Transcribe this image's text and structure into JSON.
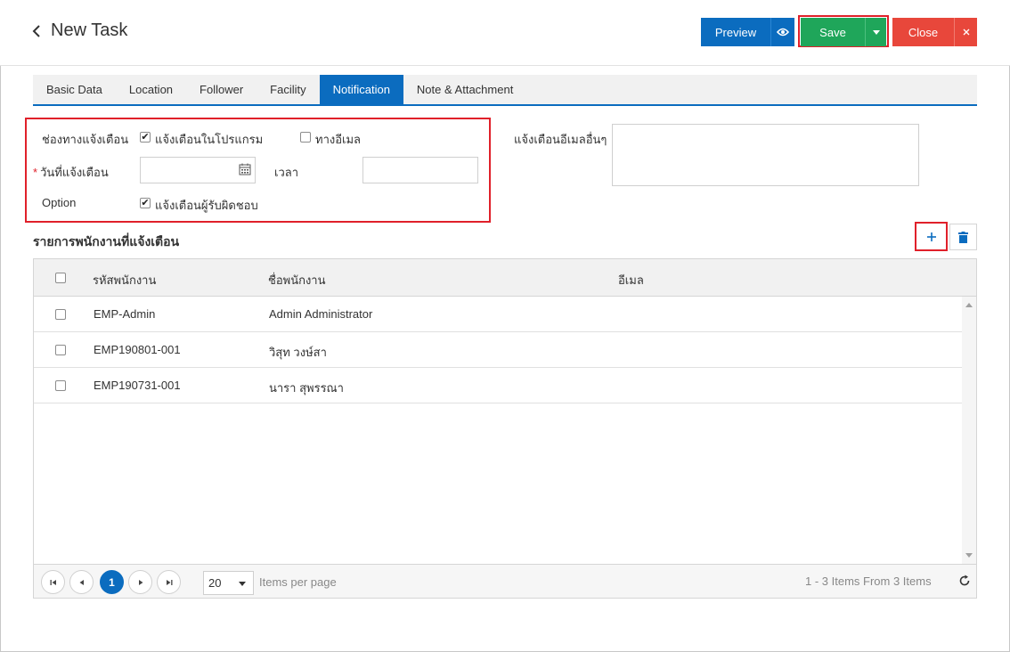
{
  "header": {
    "title": "New Task",
    "preview_label": "Preview",
    "save_label": "Save",
    "close_label": "Close"
  },
  "colors": {
    "primary": "#0b6cbf",
    "save": "#1fa65a",
    "close": "#e8473b",
    "highlight": "#e0202a"
  },
  "tabs": [
    {
      "label": "Basic Data"
    },
    {
      "label": "Location"
    },
    {
      "label": "Follower"
    },
    {
      "label": "Facility"
    },
    {
      "label": "Notification",
      "active": true
    },
    {
      "label": "Note & Attachment"
    }
  ],
  "form": {
    "channel_label": "ช่องทางแจ้งเตือน",
    "in_app_label": "แจ้งเตือนในโปรแกรม",
    "in_app_checked": true,
    "email_label": "ทางอีเมล",
    "email_checked": false,
    "date_required_mark": "*",
    "date_label": "วันที่แจ้งเตือน",
    "date_value": "",
    "time_label": "เวลา",
    "time_value": "",
    "option_label": "Option",
    "notify_owner_label": "แจ้งเตือนผู้รับผิดชอบ",
    "notify_owner_checked": true,
    "other_email_label": "แจ้งเตือนอีเมลอื่นๆ",
    "other_email_value": ""
  },
  "section": {
    "title": "รายการพนักงานที่แจ้งเตือน"
  },
  "grid": {
    "columns": [
      "รหัสพนักงาน",
      "ชื่อพนักงาน",
      "อีเมล"
    ],
    "rows": [
      {
        "code": "EMP-Admin",
        "name": "Admin Administrator",
        "email": ""
      },
      {
        "code": "EMP190801-001",
        "name": "วิสุท วงษ์สา",
        "email": ""
      },
      {
        "code": "EMP190731-001",
        "name": "นารา สุพรรณา",
        "email": ""
      }
    ]
  },
  "pager": {
    "current_page": "1",
    "page_size": "20",
    "items_per_page_label": "Items per page",
    "info": "1 - 3 Items From 3 Items"
  }
}
